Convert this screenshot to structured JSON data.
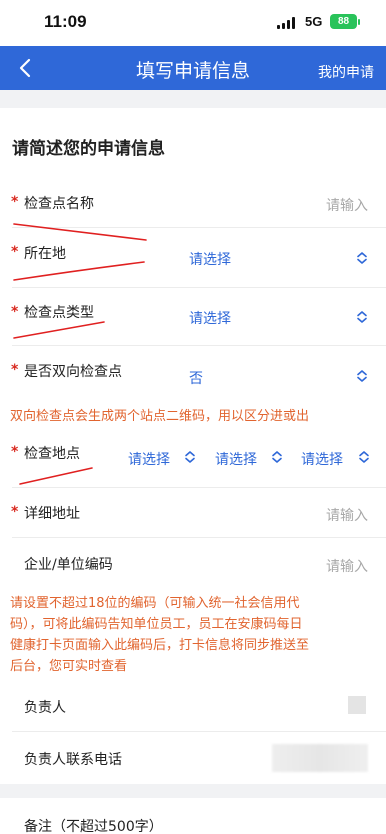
{
  "status_bar": {
    "time": "11:09",
    "network": "5G",
    "battery": "88"
  },
  "nav": {
    "title": "填写申请信息",
    "right_link": "我的申请"
  },
  "form": {
    "section_title": "请简述您的申请信息",
    "required_mark": "*",
    "checkpoint_name": {
      "label": "检查点名称",
      "placeholder": "请输入"
    },
    "location": {
      "label": "所在地",
      "value": "请选择"
    },
    "checkpoint_type": {
      "label": "检查点类型",
      "value": "请选择"
    },
    "bidirectional": {
      "label": "是否双向检查点",
      "value": "否"
    },
    "bidirectional_hint": "双向检查点会生成两个站点二维码，用以区分进或出",
    "check_location": {
      "label": "检查地点",
      "select1": "请选择",
      "select2": "请选择",
      "select3": "请选择"
    },
    "detail_address": {
      "label": "详细地址",
      "placeholder": "请输入"
    },
    "company_code": {
      "label": "企业/单位编码",
      "placeholder": "请输入"
    },
    "company_code_hint": [
      "请设置不超过18位的编码（可输入统一社会信用代",
      "码），可将此编码告知单位员工，员工在安康码每日",
      "健康打卡页面输入此编码后，打卡信息将同步推送至",
      "后台，您可实时查看"
    ],
    "person_in_charge": {
      "label": "负责人"
    },
    "contact_phone": {
      "label": "负责人联系电话"
    },
    "remark": {
      "label": "备注（不超过500字）"
    }
  },
  "colors": {
    "nav": "#2f68d8",
    "required": "#d8291f",
    "hint": "#e1642f",
    "annotation": "#e02020"
  }
}
